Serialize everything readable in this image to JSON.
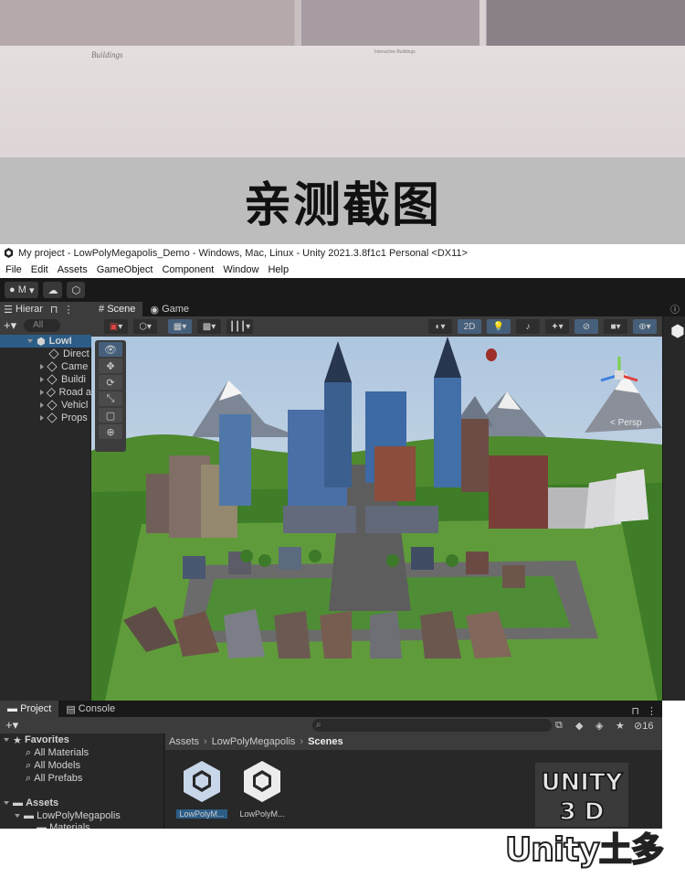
{
  "preview": {
    "caption_left": "Buildings",
    "caption_mid": "Interactive Buildings"
  },
  "banner": {
    "title": "亲测截图"
  },
  "window": {
    "title": "My project - LowPolyMegapolis_Demo - Windows, Mac, Linux - Unity 2021.3.8f1c1 Personal <DX11>"
  },
  "menu": [
    "File",
    "Edit",
    "Assets",
    "GameObject",
    "Component",
    "Window",
    "Help"
  ],
  "toolbar": {
    "account_label": "M"
  },
  "hierarchy": {
    "tab_label": "Hierar",
    "search_placeholder": "All",
    "root": "LowI",
    "items": [
      "Direct",
      "Came",
      "Buildi",
      "Road a",
      "Vehicl",
      "Props"
    ]
  },
  "scene": {
    "tabs": [
      "Scene",
      "Game"
    ],
    "mode_2d": "2D",
    "persp_label": "Persp"
  },
  "project": {
    "tabs": [
      "Project",
      "Console"
    ],
    "hidden_count": "16",
    "favorites_label": "Favorites",
    "favorites": [
      "All Materials",
      "All Models",
      "All Prefabs"
    ],
    "assets_label": "Assets",
    "assets_tree": [
      "LowPolyMegapolis",
      "Materials"
    ],
    "breadcrumb": [
      "Assets",
      "LowPolyMegapolis",
      "Scenes"
    ],
    "scene_assets": [
      "LowPolyM...",
      "LowPolyM..."
    ]
  },
  "stamp": {
    "line1": "UNITY",
    "line2": "3 D"
  },
  "watermark": {
    "text": "Unity土多"
  },
  "colors": {
    "selection": "#2c5d87",
    "panel": "#282828",
    "toolbar": "#191919",
    "accent_blue": "#46607c"
  }
}
